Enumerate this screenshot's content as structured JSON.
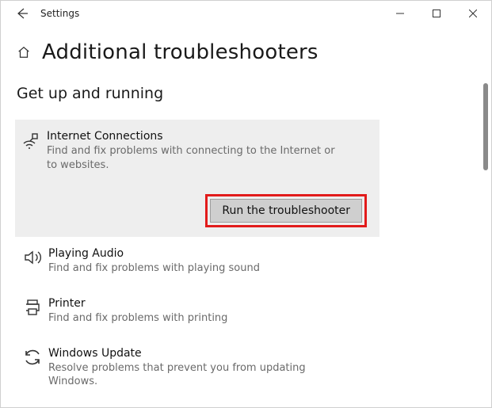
{
  "window": {
    "title": "Settings"
  },
  "page": {
    "title": "Additional troubleshooters",
    "section_heading": "Get up and running"
  },
  "items": [
    {
      "title": "Internet Connections",
      "desc": "Find and fix problems with connecting to the Internet or to websites.",
      "selected": true,
      "run_label": "Run the troubleshooter"
    },
    {
      "title": "Playing Audio",
      "desc": "Find and fix problems with playing sound"
    },
    {
      "title": "Printer",
      "desc": "Find and fix problems with printing"
    },
    {
      "title": "Windows Update",
      "desc": "Resolve problems that prevent you from updating Windows."
    }
  ]
}
